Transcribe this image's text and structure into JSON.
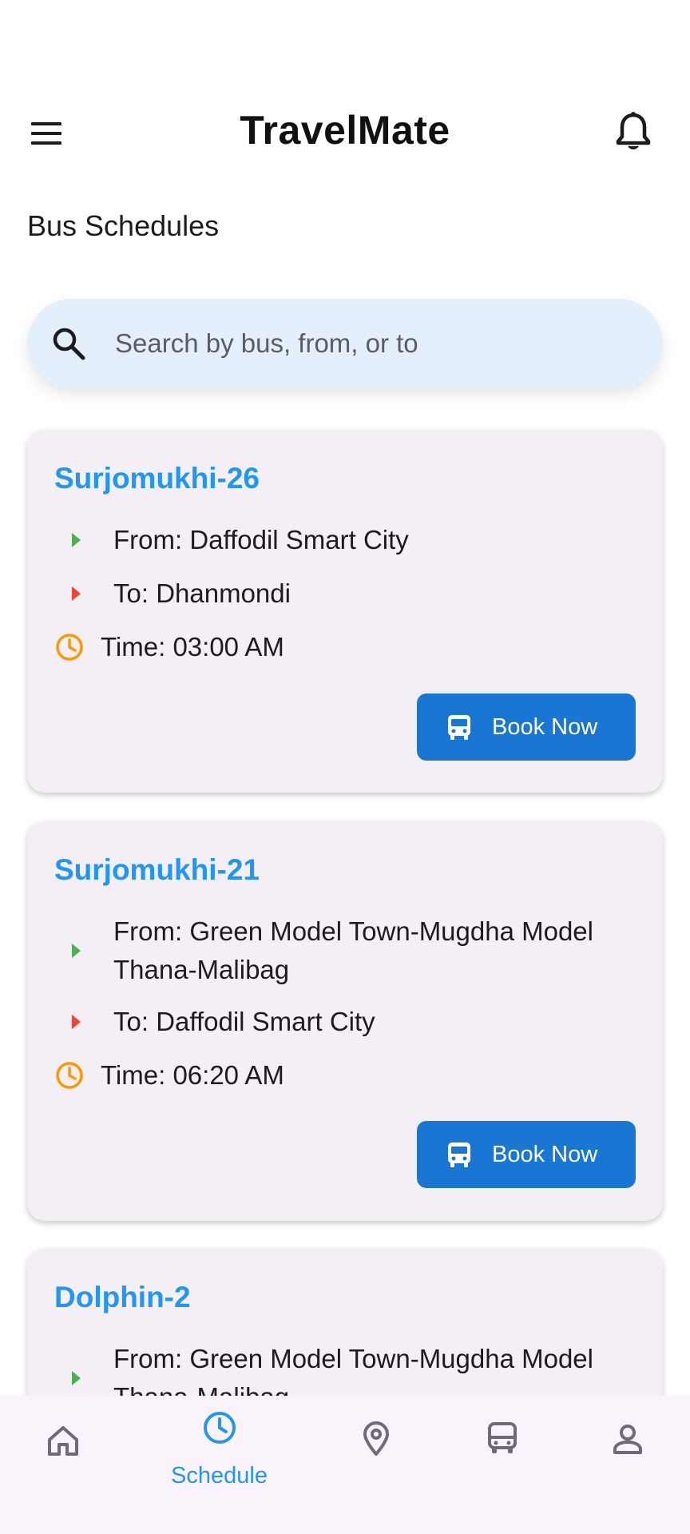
{
  "app": {
    "title": "TravelMate"
  },
  "page": {
    "title": "Bus Schedules"
  },
  "search": {
    "placeholder": "Search by bus, from, or to"
  },
  "schedules": [
    {
      "name": "Surjomukhi-26",
      "from": "From: Daffodil Smart City",
      "to": "To: Dhanmondi",
      "time": "Time: 03:00 AM",
      "book_label": "Book Now"
    },
    {
      "name": "Surjomukhi-21",
      "from_line1": "From: Green Model Town-Mugdha Model",
      "from_line2": "Thana-Malibag",
      "to": "To: Daffodil Smart City",
      "time": "Time: 06:20 AM",
      "book_label": "Book Now"
    },
    {
      "name": "Dolphin-2",
      "from_line1": "From: Green Model Town-Mugdha Model",
      "from_line2": "Thana-Malibag"
    }
  ],
  "nav": {
    "schedule_label": "Schedule"
  },
  "colors": {
    "accent": "#2196f3",
    "button": "#1976d2",
    "card_bg": "#f4eff5",
    "search_bg": "#e3f0fb",
    "from_arrow": "#4caf50",
    "to_arrow": "#f44336",
    "clock": "#ff9800"
  },
  "icons": [
    "menu-icon",
    "bell-icon",
    "search-icon",
    "clock-icon",
    "bus-icon",
    "home-icon",
    "location-pin-icon",
    "person-icon"
  ]
}
